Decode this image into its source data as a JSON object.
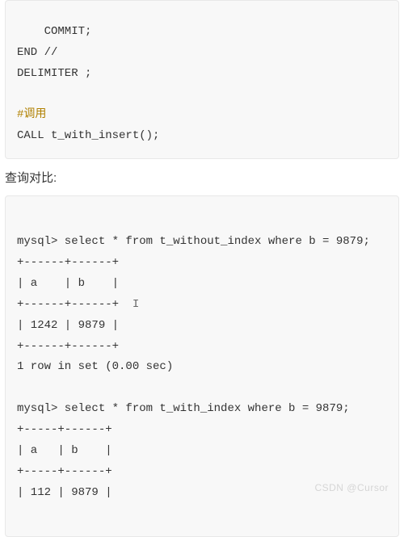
{
  "block1": {
    "l1": "    COMMIT;",
    "l2": "END //",
    "l3": "DELIMITER ;",
    "blank1": "",
    "comment": "#调用",
    "l5": "CALL t_with_insert();"
  },
  "para": {
    "text": "查询对比:"
  },
  "block2": {
    "l1": "mysql> select * from t_without_index where b = 9879;",
    "l2": "+------+------+",
    "l3": "| a    | b    |",
    "l4a": "+------+------+  ",
    "cursor": "I",
    "l5": "| 1242 | 9879 |",
    "l6": "+------+------+",
    "l7": "1 row in set (0.00 sec)",
    "blank": "",
    "l8": "mysql> select * from t_with_index where b = 9879;",
    "l9": "+-----+------+",
    "l10": "| a   | b    |",
    "l11": "+-----+------+",
    "l12": "| 112 | 9879 |"
  },
  "watermark": "CSDN @Cursor"
}
